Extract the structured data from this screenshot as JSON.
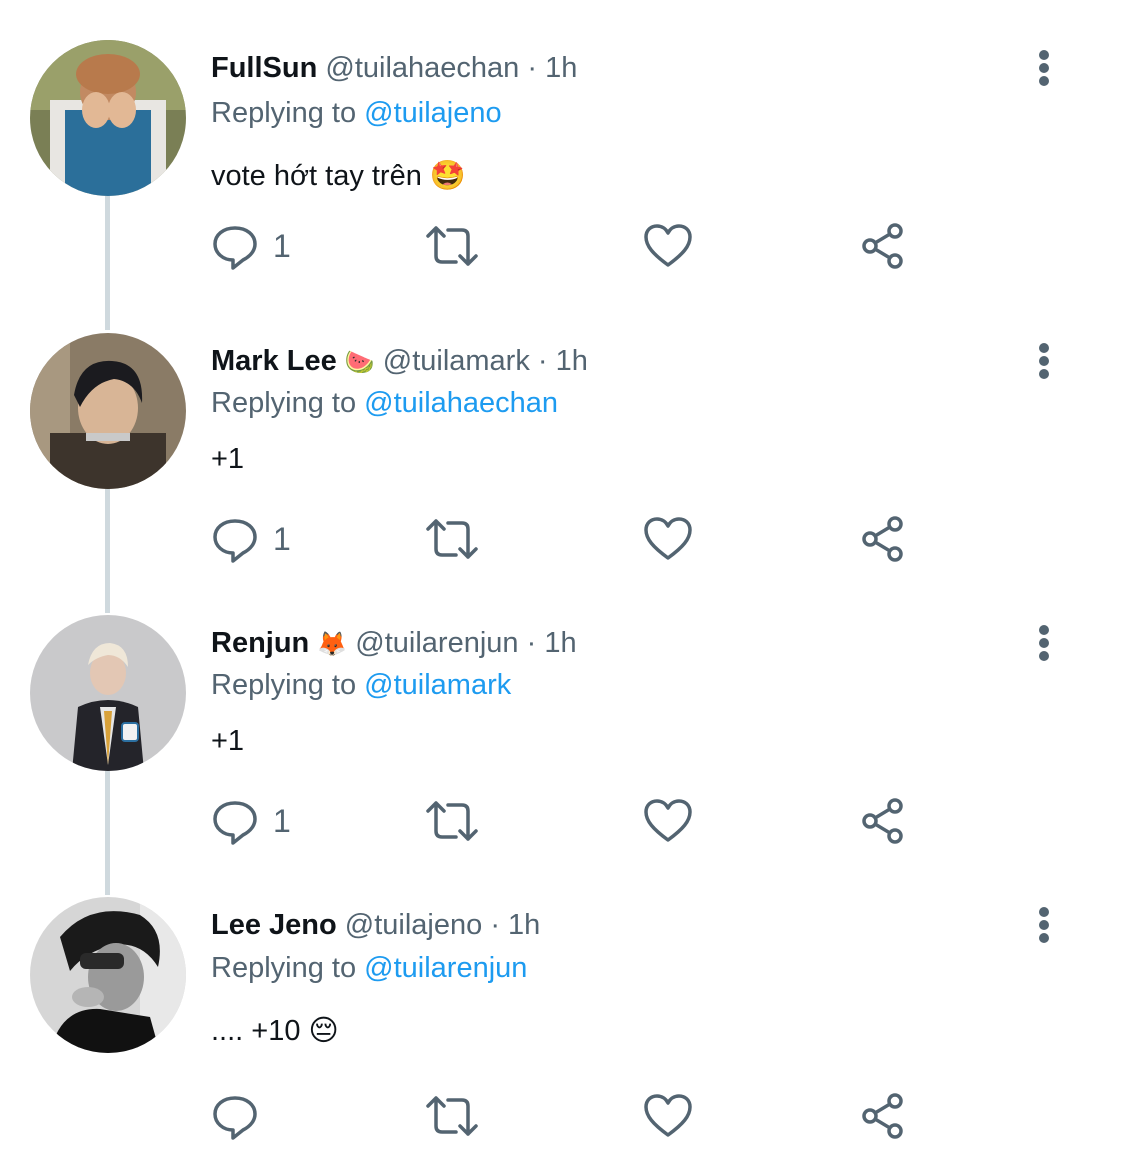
{
  "colors": {
    "mention": "#1d9bf0",
    "secondary": "#536471",
    "primary": "#0f1419",
    "thread_line": "#cfd9de"
  },
  "tweets": [
    {
      "name": "FullSun",
      "name_emoji": "",
      "handle": "@tuilahaechan",
      "sep": "·",
      "time": "1h",
      "replying_label": "Replying to",
      "replying_to": "@tuilajeno",
      "text": "vote hớt tay trên 🤩",
      "reply_count": "1",
      "avatar": "person-covering-face"
    },
    {
      "name": "Mark Lee",
      "name_emoji": "🍉",
      "handle": "@tuilamark",
      "sep": "·",
      "time": "1h",
      "replying_label": "Replying to",
      "replying_to": "@tuilahaechan",
      "text": "+1",
      "reply_count": "1",
      "avatar": "dark-haired-person"
    },
    {
      "name": "Renjun",
      "name_emoji": "🦊",
      "handle": "@tuilarenjun",
      "sep": "·",
      "time": "1h",
      "replying_label": "Replying to",
      "replying_to": "@tuilamark",
      "text": "+1",
      "reply_count": "1",
      "avatar": "person-in-suit"
    },
    {
      "name": "Lee Jeno",
      "name_emoji": "",
      "handle": "@tuilajeno",
      "sep": "·",
      "time": "1h",
      "replying_label": "Replying to",
      "replying_to": "@tuilarenjun",
      "text": ".... +10 😔",
      "reply_count": "",
      "avatar": "black-and-white-portrait"
    }
  ]
}
